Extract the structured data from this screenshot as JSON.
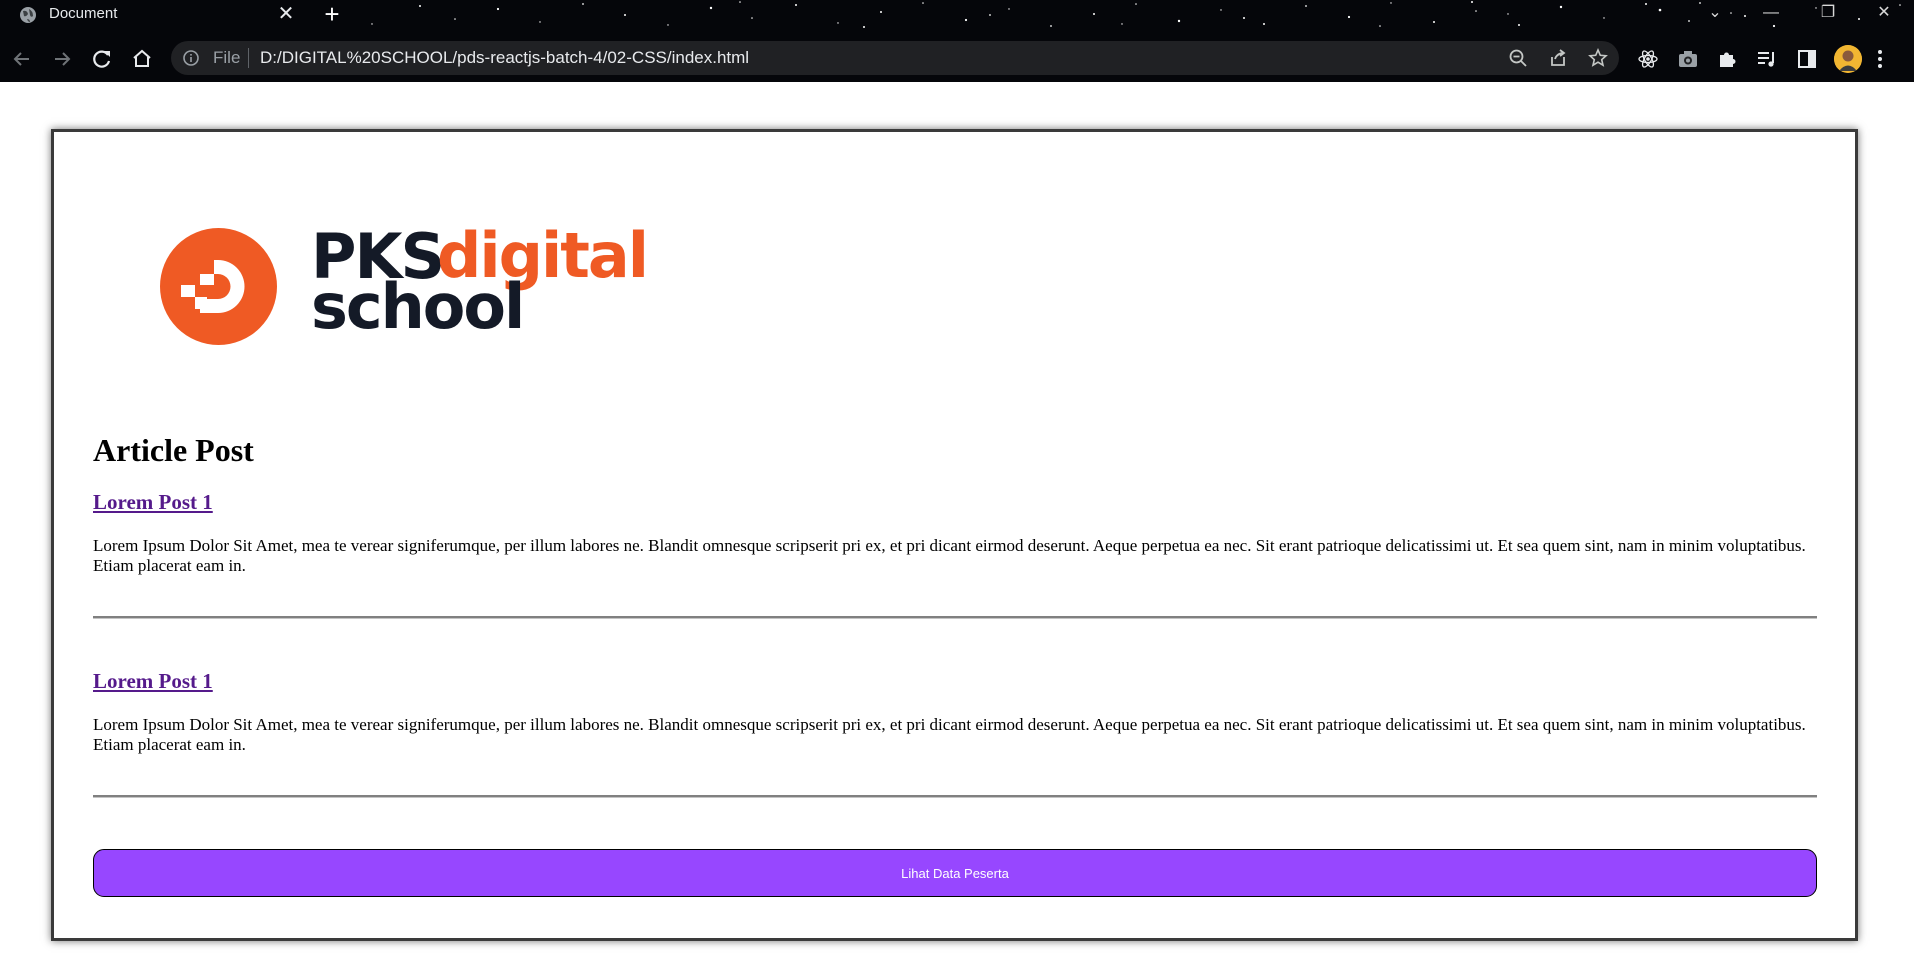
{
  "browser": {
    "tab_title": "Document",
    "url_scheme": "File",
    "url": "D:/DIGITAL%20SCHOOL/pds-reactjs-batch-4/02-CSS/index.html",
    "theme_color": "#05060a"
  },
  "logo": {
    "word_1": "PKS",
    "word_2": "digital",
    "word_3": "school",
    "brand_orange": "#ef5a24",
    "brand_dark": "#141a27"
  },
  "article": {
    "heading": "Article Post",
    "posts": [
      {
        "title": "Lorem Post 1",
        "body": "Lorem Ipsum Dolor Sit Amet, mea te verear signiferumque, per illum labores ne. Blandit omnesque scripserit pri ex, et pri dicant eirmod deserunt. Aeque perpetua ea nec. Sit erant patrioque delicatissimi ut. Et sea quem sint, nam in minim voluptatibus. Etiam placerat eam in."
      },
      {
        "title": "Lorem Post 1",
        "body": "Lorem Ipsum Dolor Sit Amet, mea te verear signiferumque, per illum labores ne. Blandit omnesque scripserit pri ex, et pri dicant eirmod deserunt. Aeque perpetua ea nec. Sit erant patrioque delicatissimi ut. Et sea quem sint, nam in minim voluptatibus. Etiam placerat eam in."
      }
    ]
  },
  "cta": {
    "label": "Lihat Data Peserta",
    "color": "#9747ff"
  },
  "icons": {
    "tab_favicon": "globe-icon",
    "back": "arrow-left-icon",
    "forward": "arrow-right-icon",
    "reload": "reload-icon",
    "home": "home-icon",
    "info": "info-icon",
    "zoom": "zoom-out-icon",
    "share": "share-icon",
    "bookmark": "star-icon",
    "extensions": [
      "react-devtools-icon",
      "camera-icon",
      "puzzle-icon",
      "media-control-icon",
      "side-panel-icon"
    ]
  }
}
